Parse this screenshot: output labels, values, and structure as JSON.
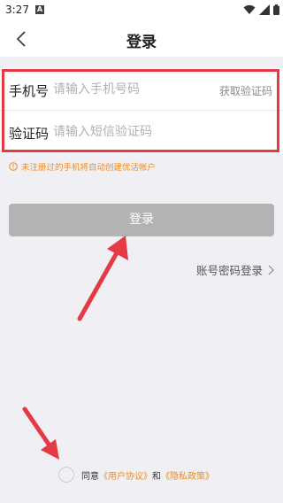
{
  "status_bar": {
    "time": "3:27",
    "app_icon_letter": "A"
  },
  "header": {
    "title": "登录"
  },
  "form": {
    "phone_label": "手机号",
    "phone_placeholder": "请输入手机号码",
    "get_code_label": "获取验证码",
    "code_label": "验证码",
    "code_placeholder": "请输入短信验证码"
  },
  "notice": "未注册过的手机将自动创建优活帐户",
  "login_button": "登录",
  "password_login": "账号密码登录",
  "agreement": {
    "prefix": "同意",
    "user_agreement": "《用户协议》",
    "conjunction": "和",
    "privacy_policy": "《隐私政策》"
  },
  "colors": {
    "accent": "#f08c1e",
    "annotation": "#e53945",
    "button_disabled": "#b3b3b3",
    "background": "#efeff4"
  },
  "icons": [
    "back-chevron",
    "wifi",
    "signal",
    "battery",
    "info-circle",
    "chevron-right"
  ]
}
